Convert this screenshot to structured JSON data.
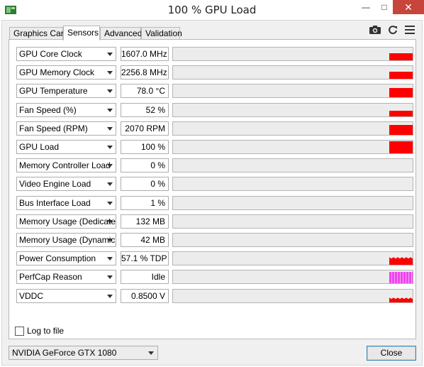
{
  "window": {
    "title": "100 % GPU Load",
    "minimize": "—",
    "maximize": "□",
    "close": "✕"
  },
  "tabs": [
    {
      "label": "Graphics Card",
      "active": false
    },
    {
      "label": "Sensors",
      "active": true
    },
    {
      "label": "Advanced",
      "active": false
    },
    {
      "label": "Validation",
      "active": false
    }
  ],
  "toolbar": {
    "camera_icon": "camera-icon",
    "refresh_icon": "refresh-icon",
    "menu_icon": "hamburger-menu-icon"
  },
  "sensors": [
    {
      "name": "GPU Core Clock",
      "value": "1607.0 MHz",
      "graph_level": 0.55,
      "graph_style": "solid"
    },
    {
      "name": "GPU Memory Clock",
      "value": "2256.8 MHz",
      "graph_level": 0.55,
      "graph_style": "solid"
    },
    {
      "name": "GPU Temperature",
      "value": "78.0 °C",
      "graph_level": 0.7,
      "graph_style": "solid"
    },
    {
      "name": "Fan Speed (%)",
      "value": "52 %",
      "graph_level": 0.45,
      "graph_style": "solid"
    },
    {
      "name": "Fan Speed (RPM)",
      "value": "2070 RPM",
      "graph_level": 0.75,
      "graph_style": "solid"
    },
    {
      "name": "GPU Load",
      "value": "100 %",
      "graph_level": 0.95,
      "graph_style": "solid"
    },
    {
      "name": "Memory Controller Load",
      "value": "0 %",
      "graph_level": 0,
      "graph_style": "solid"
    },
    {
      "name": "Video Engine Load",
      "value": "0 %",
      "graph_level": 0,
      "graph_style": "solid"
    },
    {
      "name": "Bus Interface Load",
      "value": "1 %",
      "graph_level": 0,
      "graph_style": "solid"
    },
    {
      "name": "Memory Usage (Dedicated)",
      "value": "132 MB",
      "graph_level": 0,
      "graph_style": "solid"
    },
    {
      "name": "Memory Usage (Dynamic)",
      "value": "42 MB",
      "graph_level": 0,
      "graph_style": "solid"
    },
    {
      "name": "Power Consumption",
      "value": "57.1 % TDP",
      "graph_level": 0.55,
      "graph_style": "spiky"
    },
    {
      "name": "PerfCap Reason",
      "value": "Idle",
      "graph_level": 0.9,
      "graph_style": "stripes"
    },
    {
      "name": "VDDC",
      "value": "0.8500 V",
      "graph_level": 0.3,
      "graph_style": "spiky"
    }
  ],
  "log_to_file": {
    "label": "Log to file",
    "checked": false
  },
  "gpu_select": {
    "selected": "NVIDIA GeForce GTX 1080"
  },
  "close_button": {
    "label": "Close"
  },
  "colors": {
    "graph_bar": "#ff0000",
    "perfcap_bar": "#ee44ee",
    "graph_bg": "#ececec",
    "close_accent": "#c7453a"
  }
}
